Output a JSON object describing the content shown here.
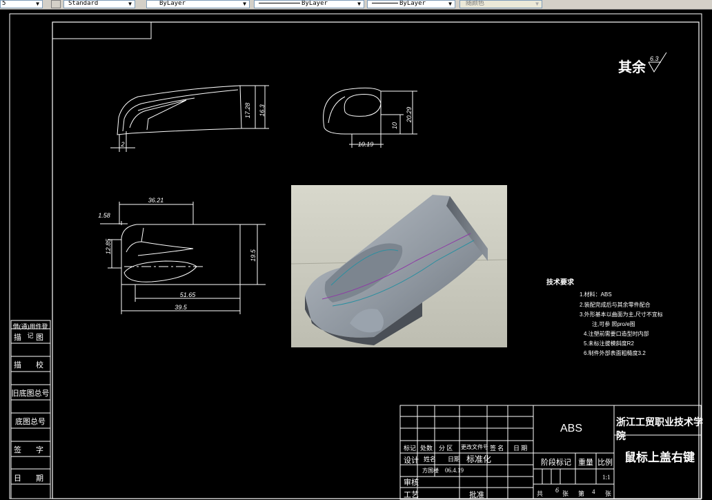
{
  "toolbar": {
    "items": [
      {
        "label": "5"
      },
      {
        "label": "Standard"
      },
      {
        "label": "ByLayer"
      },
      {
        "label": "ByLayer"
      },
      {
        "label": "ByLayer"
      },
      {
        "label": "随颜色"
      }
    ]
  },
  "drawing": {
    "roughness": {
      "label": "其余",
      "value": "6.3"
    },
    "dims": {
      "side_h1": "17.28",
      "side_h2": "16.3",
      "side_w": "2",
      "front_w": "10.19",
      "front_h1": "10",
      "front_h2": "20.29",
      "top_w1": "36.21",
      "top_w2": "1.58",
      "top_h1": "12.85",
      "top_h2": "19.5",
      "top_w3": "51.65",
      "top_w4": "39.5"
    },
    "tech_req": {
      "title": "技术要求",
      "lines": [
        "1.材料：ABS",
        "2.装配完成后与其余零件配合",
        "3.外形基本以曲面为主,尺寸不宜标",
        "注,可参 照pro/e图",
        "4.注塑前需要口造型时内部",
        "5.未标注拔模斜度R2",
        "6.制件外部表面粗糙度3.2"
      ]
    }
  },
  "side_labels": [
    "借(通)用件登记",
    "描　图",
    "描　校",
    "旧底图总号",
    "底图总号",
    "签　字",
    "日　期"
  ],
  "title_block": {
    "material": "ABS",
    "school": "浙江工贸职业技术学院",
    "part_name": "鼠标上盖右键",
    "header_row": [
      "标记",
      "处数",
      "分 区",
      "更改文件号",
      "签 名",
      "日 期"
    ],
    "design_label": "设计",
    "name_label": "姓名",
    "date_label": "日期",
    "std_label": "标准化",
    "designer": "方国楼",
    "design_date": "06.4.19",
    "check_label": "审核",
    "process_label": "工艺",
    "approve_label": "批准",
    "stage_label": "阶段标记",
    "weight_label": "重量",
    "scale_label": "比例",
    "scale_value": "1:1",
    "total_prefix": "共",
    "total_value": "6",
    "total_unit": "张",
    "page_prefix": "第",
    "page_value": "4",
    "page_unit": "张"
  }
}
